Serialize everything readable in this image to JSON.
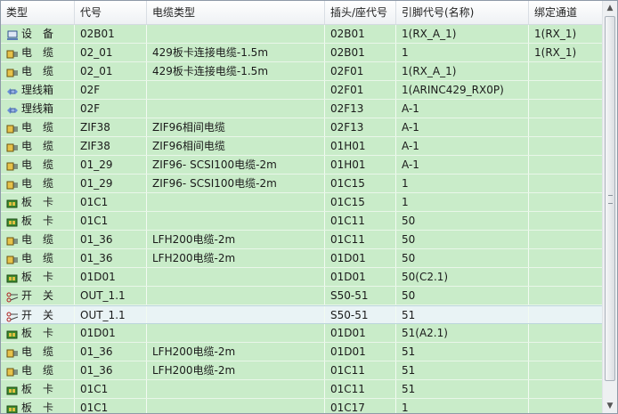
{
  "columns": [
    "类型",
    "代号",
    "电缆类型",
    "插头/座代号",
    "引脚代号(名称)",
    "绑定通道"
  ],
  "rows": [
    {
      "type": "设　备",
      "icon": "device-icon",
      "code": "02B01",
      "cable": "",
      "plug": "02B01",
      "pin": "1(RX_A_1)",
      "channel": "1(RX_1)"
    },
    {
      "type": "电　缆",
      "icon": "cable-icon",
      "code": "02_01",
      "cable": "429板卡连接电缆-1.5m",
      "plug": "02B01",
      "pin": "1",
      "channel": "1(RX_1)"
    },
    {
      "type": "电　缆",
      "icon": "cable-icon",
      "code": "02_01",
      "cable": "429板卡连接电缆-1.5m",
      "plug": "02F01",
      "pin": "1(RX_A_1)",
      "channel": ""
    },
    {
      "type": "理线箱",
      "icon": "junction-box-icon",
      "code": "02F",
      "cable": "",
      "plug": "02F01",
      "pin": "1(ARINC429_RX0P)",
      "channel": ""
    },
    {
      "type": "理线箱",
      "icon": "junction-box-icon",
      "code": "02F",
      "cable": "",
      "plug": "02F13",
      "pin": "A-1",
      "channel": ""
    },
    {
      "type": "电　缆",
      "icon": "cable-icon",
      "code": "ZIF38",
      "cable": "ZIF96相间电缆",
      "plug": "02F13",
      "pin": "A-1",
      "channel": ""
    },
    {
      "type": "电　缆",
      "icon": "cable-icon",
      "code": "ZIF38",
      "cable": "ZIF96相间电缆",
      "plug": "01H01",
      "pin": "A-1",
      "channel": ""
    },
    {
      "type": "电　缆",
      "icon": "cable-icon",
      "code": "01_29",
      "cable": "ZIF96- SCSI100电缆-2m",
      "plug": "01H01",
      "pin": "A-1",
      "channel": ""
    },
    {
      "type": "电　缆",
      "icon": "cable-icon",
      "code": "01_29",
      "cable": "ZIF96- SCSI100电缆-2m",
      "plug": "01C15",
      "pin": "1",
      "channel": ""
    },
    {
      "type": "板　卡",
      "icon": "board-icon",
      "code": "01C1",
      "cable": "",
      "plug": "01C15",
      "pin": "1",
      "channel": ""
    },
    {
      "type": "板　卡",
      "icon": "board-icon",
      "code": "01C1",
      "cable": "",
      "plug": "01C11",
      "pin": "50",
      "channel": ""
    },
    {
      "type": "电　缆",
      "icon": "cable-icon",
      "code": "01_36",
      "cable": "LFH200电缆-2m",
      "plug": "01C11",
      "pin": "50",
      "channel": ""
    },
    {
      "type": "电　缆",
      "icon": "cable-icon",
      "code": "01_36",
      "cable": "LFH200电缆-2m",
      "plug": "01D01",
      "pin": "50",
      "channel": ""
    },
    {
      "type": "板　卡",
      "icon": "board-icon",
      "code": "01D01",
      "cable": "",
      "plug": "01D01",
      "pin": "50(C2.1)",
      "channel": ""
    },
    {
      "type": "开　关",
      "icon": "switch-icon",
      "code": "OUT_1.1",
      "cable": "",
      "plug": "S50-51",
      "pin": "50",
      "channel": ""
    },
    {
      "type": "开　关",
      "icon": "switch-icon",
      "code": "OUT_1.1",
      "cable": "",
      "plug": "S50-51",
      "pin": "51",
      "channel": "",
      "selected": true
    },
    {
      "type": "板　卡",
      "icon": "board-icon",
      "code": "01D01",
      "cable": "",
      "plug": "01D01",
      "pin": "51(A2.1)",
      "channel": ""
    },
    {
      "type": "电　缆",
      "icon": "cable-icon",
      "code": "01_36",
      "cable": "LFH200电缆-2m",
      "plug": "01D01",
      "pin": "51",
      "channel": ""
    },
    {
      "type": "电　缆",
      "icon": "cable-icon",
      "code": "01_36",
      "cable": "LFH200电缆-2m",
      "plug": "01C11",
      "pin": "51",
      "channel": ""
    },
    {
      "type": "板　卡",
      "icon": "board-icon",
      "code": "01C1",
      "cable": "",
      "plug": "01C11",
      "pin": "51",
      "channel": ""
    },
    {
      "type": "板　卡",
      "icon": "board-icon",
      "code": "01C1",
      "cable": "",
      "plug": "01C17",
      "pin": "1",
      "channel": ""
    }
  ]
}
